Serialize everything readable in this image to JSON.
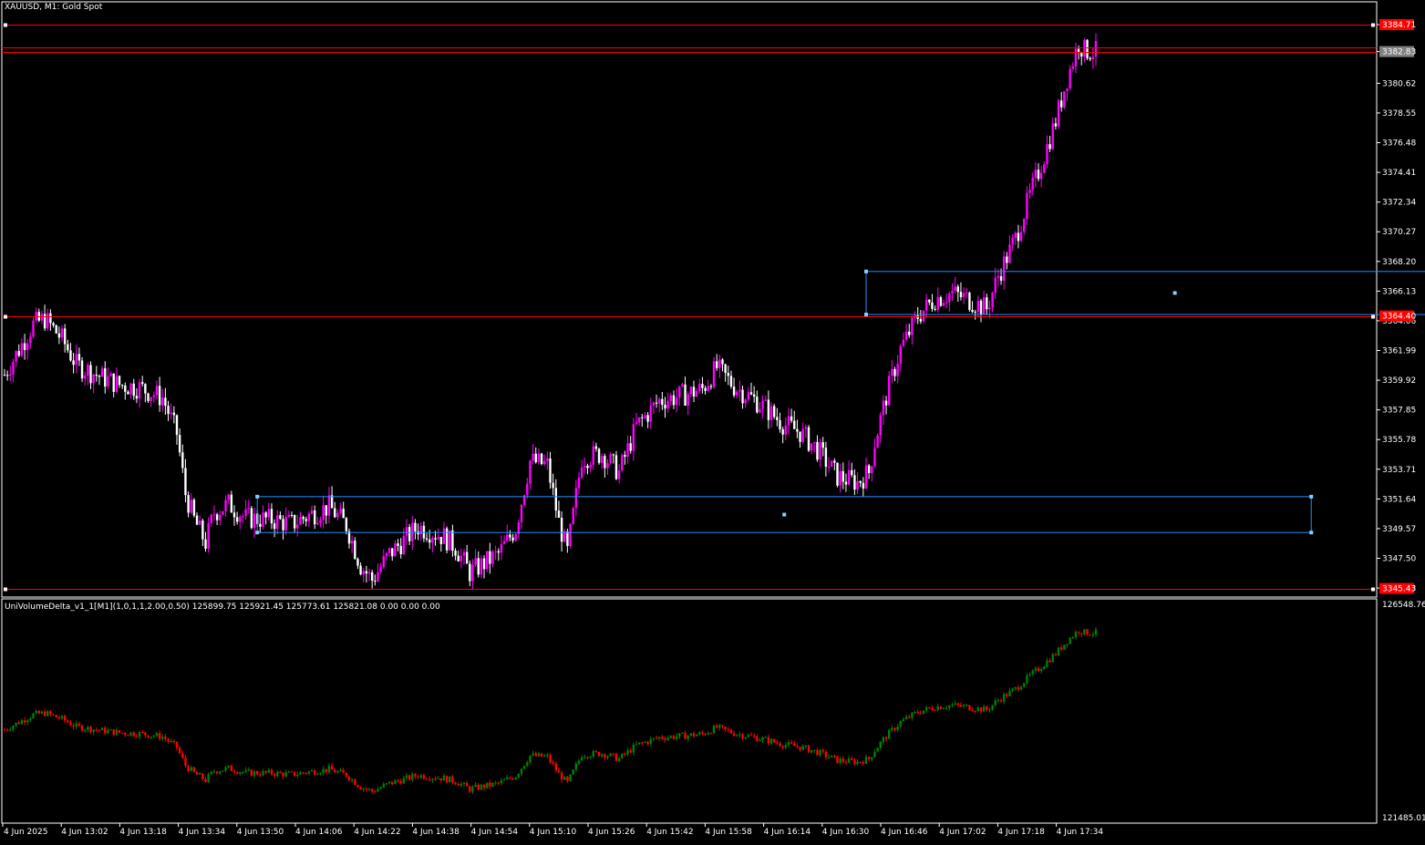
{
  "window": {
    "title": "XAUUSD, M1:  Gold Spot"
  },
  "colors": {
    "background": "#000000",
    "frame": "#ffffff",
    "bull_body": "#ff00ff",
    "bear_body": "#ffffff",
    "hline": "#ff0000",
    "rect": "#1e90ff",
    "handle": "#87cefa",
    "delta_up": "#008000",
    "delta_down": "#ff0000",
    "price_tag_red": "#ff0000",
    "price_tag_gray": "#808080"
  },
  "main_chart": {
    "price_axis_labels": [
      "3384.71",
      "3382.83",
      "3380.62",
      "3378.55",
      "3376.48",
      "3374.41",
      "3372.34",
      "3370.27",
      "3368.20",
      "3366.13",
      "3364.06",
      "3361.99",
      "3359.92",
      "3357.85",
      "3355.78",
      "3353.71",
      "3351.64",
      "3349.57",
      "3347.50",
      "3345.43"
    ],
    "ylim": [
      3344.8,
      3386.3
    ],
    "horizontal_lines": [
      {
        "name": "resistance-top",
        "price": 3384.71,
        "tag": "3384.71",
        "tag_color": "#ff0000"
      },
      {
        "name": "bid-line",
        "price": 3382.83,
        "tag": "3382.83",
        "tag_color": "#808080"
      },
      {
        "name": "ask-line",
        "price": 3383.1,
        "tag": "",
        "tag_color": ""
      },
      {
        "name": "level-mid",
        "price": 3364.4,
        "tag": "3364.40",
        "tag_color": "#ff0000"
      },
      {
        "name": "level-low",
        "price": 3345.4,
        "tag": "3345.43",
        "tag_color": "#ff0000"
      }
    ],
    "rectangles": [
      {
        "name": "zone-upper",
        "t1": 300,
        "t2": 515,
        "p1": 3367.5,
        "p2": 3364.5
      },
      {
        "name": "zone-lower",
        "t1": 88,
        "t2": 455,
        "p1": 3351.8,
        "p2": 3349.3
      }
    ]
  },
  "time_axis": {
    "labels": [
      "4 Jun 2025",
      "4 Jun 13:02",
      "4 Jun 13:18",
      "4 Jun 13:34",
      "4 Jun 13:50",
      "4 Jun 14:06",
      "4 Jun 14:22",
      "4 Jun 14:38",
      "4 Jun 14:54",
      "4 Jun 15:10",
      "4 Jun 15:26",
      "4 Jun 15:42",
      "4 Jun 15:58",
      "4 Jun 16:14",
      "4 Jun 16:30",
      "4 Jun 16:46",
      "4 Jun 17:02",
      "4 Jun 17:18",
      "4 Jun 17:34"
    ]
  },
  "indicator": {
    "label": "UniVolumeDelta_v1_1[M1](1,0,1,1,2.00,0.50) 125899.75 125921.45 125773.61 125821.08 0.00 0.00 0.00",
    "axis_labels": [
      "126548.76",
      "121485.01"
    ],
    "ylim": [
      121485.01,
      126548.76
    ]
  },
  "chart_data": {
    "type": "candlestick",
    "symbol": "XAUUSD",
    "timeframe": "M1",
    "x_start": "4 Jun 2025 12:46",
    "close_path": [
      [
        0,
        3360.3
      ],
      [
        10,
        3363.8
      ],
      [
        14,
        3364.2
      ],
      [
        20,
        3362.8
      ],
      [
        25,
        3361.0
      ],
      [
        33,
        3360.2
      ],
      [
        40,
        3359.6
      ],
      [
        47,
        3359.4
      ],
      [
        55,
        3358.7
      ],
      [
        60,
        3356.2
      ],
      [
        63,
        3352.0
      ],
      [
        66,
        3350.2
      ],
      [
        70,
        3348.6
      ],
      [
        73,
        3350.7
      ],
      [
        78,
        3351.3
      ],
      [
        84,
        3350.3
      ],
      [
        93,
        3350.2
      ],
      [
        100,
        3349.9
      ],
      [
        106,
        3350.5
      ],
      [
        113,
        3351.1
      ],
      [
        119,
        3349.8
      ],
      [
        124,
        3347.0
      ],
      [
        128,
        3346.0
      ],
      [
        134,
        3347.8
      ],
      [
        144,
        3349.7
      ],
      [
        153,
        3349.0
      ],
      [
        157,
        3348.3
      ],
      [
        162,
        3346.5
      ],
      [
        172,
        3347.8
      ],
      [
        178,
        3349.6
      ],
      [
        183,
        3354.3
      ],
      [
        189,
        3354.0
      ],
      [
        193,
        3350.0
      ],
      [
        196,
        3347.9
      ],
      [
        201,
        3354.5
      ],
      [
        208,
        3354.8
      ],
      [
        214,
        3353.5
      ],
      [
        220,
        3356.7
      ],
      [
        228,
        3358.5
      ],
      [
        235,
        3358.8
      ],
      [
        243,
        3359.3
      ],
      [
        248,
        3360.8
      ],
      [
        254,
        3359.5
      ],
      [
        263,
        3358.3
      ],
      [
        271,
        3356.9
      ],
      [
        277,
        3356.3
      ],
      [
        283,
        3355.1
      ],
      [
        290,
        3353.2
      ],
      [
        297,
        3352.8
      ],
      [
        301,
        3353.5
      ],
      [
        303,
        3355.6
      ],
      [
        307,
        3358.8
      ],
      [
        312,
        3362.1
      ],
      [
        318,
        3364.4
      ],
      [
        324,
        3365.6
      ],
      [
        330,
        3366.0
      ],
      [
        335,
        3365.6
      ],
      [
        342,
        3364.9
      ],
      [
        346,
        3367.2
      ],
      [
        352,
        3369.8
      ],
      [
        357,
        3372.8
      ],
      [
        361,
        3375.0
      ],
      [
        366,
        3378.0
      ],
      [
        370,
        3381.0
      ],
      [
        374,
        3383.4
      ],
      [
        376,
        3382.9
      ],
      [
        380,
        3382.8
      ]
    ],
    "note_x_units": "minutes since x_start"
  }
}
